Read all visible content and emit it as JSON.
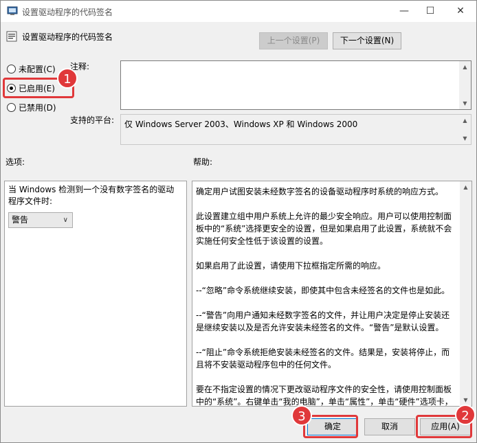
{
  "window": {
    "title": "设置驱动程序的代码签名",
    "minimize_glyph": "—",
    "maximize_glyph": "☐",
    "close_glyph": "✕"
  },
  "header": {
    "title": "设置驱动程序的代码签名",
    "prev_button": "上一个设置(P)",
    "next_button": "下一个设置(N)"
  },
  "state": {
    "options": [
      {
        "label": "未配置(C)",
        "checked": false
      },
      {
        "label": "已启用(E)",
        "checked": true
      },
      {
        "label": "已禁用(D)",
        "checked": false
      }
    ]
  },
  "comment": {
    "label": "注释:",
    "value": ""
  },
  "platform": {
    "label": "支持的平台:",
    "value": "仅 Windows Server 2003、Windows XP 和 Windows 2000"
  },
  "options_section": {
    "label": "选项:",
    "description": "当 Windows 检测到一个没有数字签名的驱动程序文件时:",
    "selected": "警告"
  },
  "help_section": {
    "label": "帮助:",
    "paragraphs": [
      "确定用户试图安装未经数字签名的设备驱动程序时系统的响应方式。",
      "此设置建立组中用户系统上允许的最少安全响应。用户可以使用控制面板中的“系统”选择更安全的设置，但是如果启用了此设置，系统就不会实施任何安全性低于该设置的设置。",
      "如果启用了此设置，请使用下拉框指定所需的响应。",
      "--“忽略”命令系统继续安装，即使其中包含未经签名的文件也是如此。",
      "--“警告”向用户通知未经数字签名的文件，并让用户决定是停止安装还是继续安装以及是否允许安装未经签名的文件。“警告”是默认设置。",
      "--“阻止”命令系统拒绝安装未经签名的文件。结果是，安装将停止，而且将不安装驱动程序包中的任何文件。",
      "要在不指定设置的情况下更改驱动程序文件的安全性，请使用控制面板中的“系统”。右键单击“我的电脑”，单击“属性”，单击“硬件”选项卡，然后单击“驱动程序签名”按钮。"
    ]
  },
  "footer": {
    "ok": "确定",
    "cancel": "取消",
    "apply": "应用(A)"
  },
  "annotations": [
    "1",
    "2",
    "3"
  ],
  "colors": {
    "annotation": "#e0383a",
    "window_bg": "#f0f0f0"
  }
}
